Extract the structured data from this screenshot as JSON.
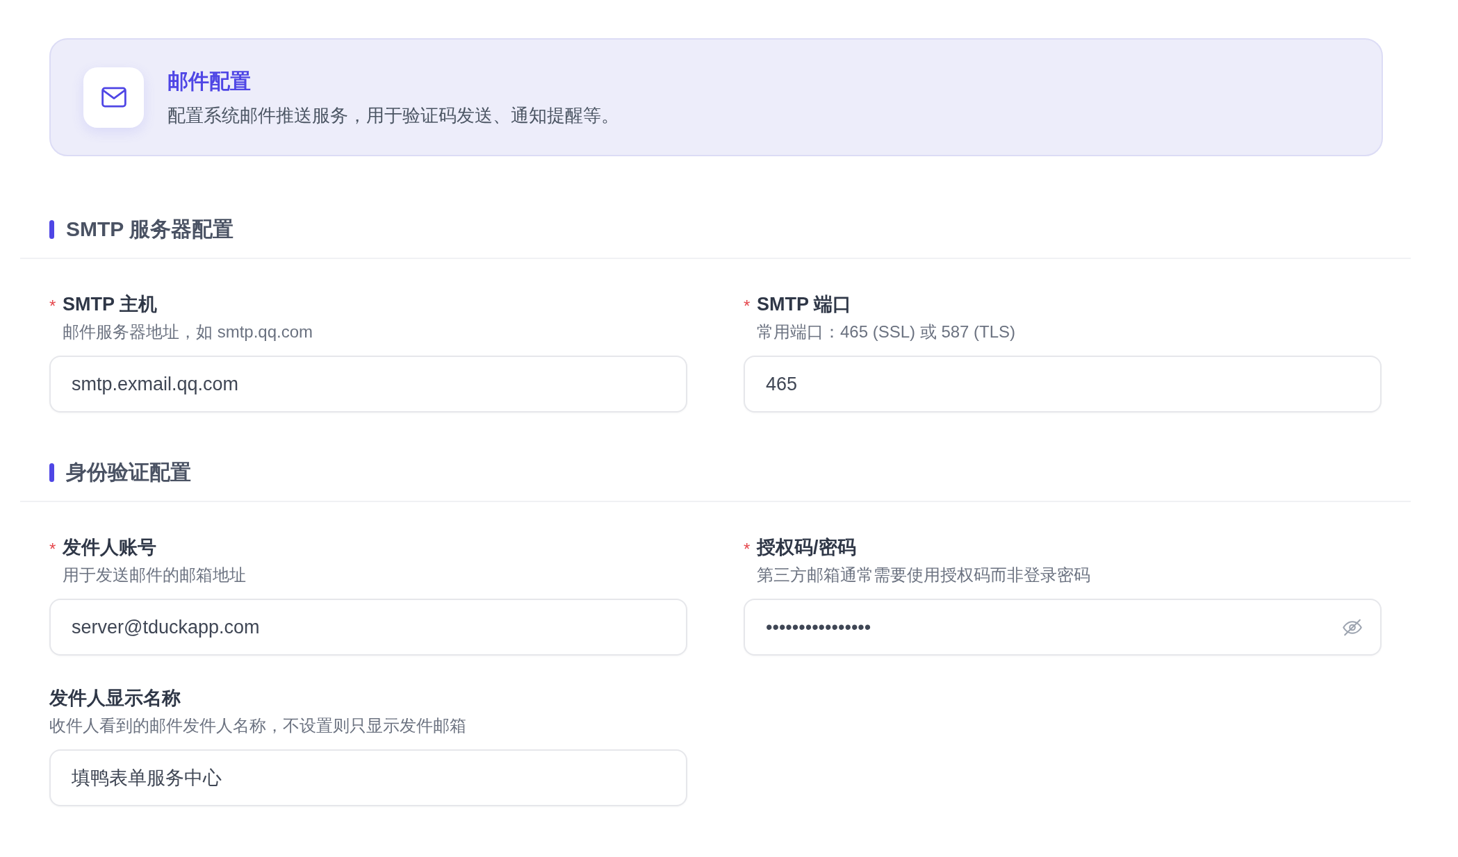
{
  "header": {
    "title": "邮件配置",
    "description": "配置系统邮件推送服务，用于验证码发送、通知提醒等。"
  },
  "sections": [
    {
      "title": "SMTP 服务器配置",
      "fields": [
        {
          "kind": "text",
          "required": true,
          "required_mark": "*",
          "label": "SMTP 主机",
          "hint": "邮件服务器地址，如 smtp.qq.com",
          "value": "smtp.exmail.qq.com"
        },
        {
          "kind": "text",
          "required": true,
          "required_mark": "*",
          "label": "SMTP 端口",
          "hint": "常用端口：465 (SSL) 或 587 (TLS)",
          "value": "465"
        }
      ]
    },
    {
      "title": "身份验证配置",
      "fields": [
        {
          "kind": "text",
          "required": true,
          "required_mark": "*",
          "label": "发件人账号",
          "hint": "用于发送邮件的邮箱地址",
          "value": "server@tduckapp.com"
        },
        {
          "kind": "password",
          "required": true,
          "required_mark": "*",
          "label": "授权码/密码",
          "hint": "第三方邮箱通常需要使用授权码而非登录密码",
          "value": "••••••••••••••••"
        },
        {
          "kind": "text",
          "required": false,
          "label": "发件人显示名称",
          "hint": "收件人看到的邮件发件人名称，不设置则只显示发件邮箱",
          "value": "填鸭表单服务中心"
        }
      ]
    }
  ]
}
